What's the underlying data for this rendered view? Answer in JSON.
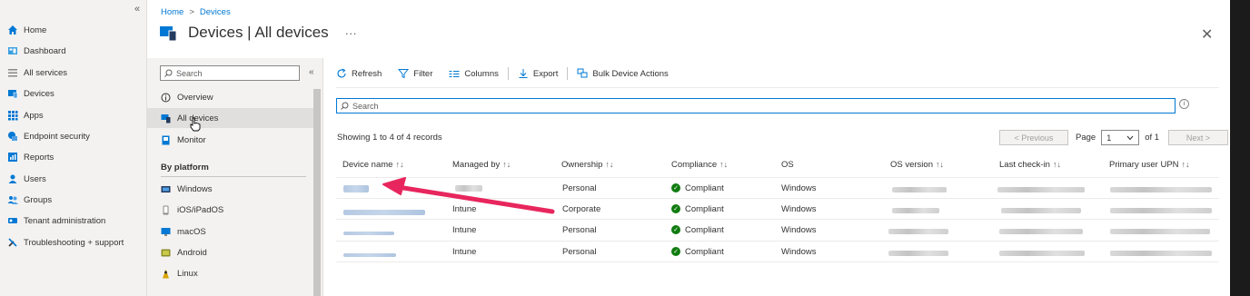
{
  "leftnav": {
    "collapse_glyph": "«",
    "items": [
      {
        "label": "Home",
        "icon": "home-icon",
        "color": "#0078d4"
      },
      {
        "label": "Dashboard",
        "icon": "dashboard-icon",
        "color": "#3aa0e0"
      },
      {
        "label": "All services",
        "icon": "list-icon",
        "color": "#8a8886"
      },
      {
        "label": "Devices",
        "icon": "devices-icon",
        "color": "#0078d4"
      },
      {
        "label": "Apps",
        "icon": "apps-icon",
        "color": "#0078d4"
      },
      {
        "label": "Endpoint security",
        "icon": "endpoint-security-icon",
        "color": "#0078d4"
      },
      {
        "label": "Reports",
        "icon": "reports-icon",
        "color": "#0078d4"
      },
      {
        "label": "Users",
        "icon": "users-icon",
        "color": "#0078d4"
      },
      {
        "label": "Groups",
        "icon": "groups-icon",
        "color": "#0078d4"
      },
      {
        "label": "Tenant administration",
        "icon": "tenant-admin-icon",
        "color": "#0078d4"
      },
      {
        "label": "Troubleshooting + support",
        "icon": "wrench-icon",
        "color": "#323130"
      }
    ]
  },
  "breadcrumb": {
    "home": "Home",
    "sep": ">",
    "current": "Devices"
  },
  "header": {
    "title": "Devices | All devices",
    "more": "···",
    "close": "✕"
  },
  "blade": {
    "search_placeholder": "Search",
    "collapse": "«",
    "items": [
      {
        "label": "Overview",
        "icon": "info-icon"
      },
      {
        "label": "All devices",
        "icon": "all-devices-icon",
        "selected": true
      },
      {
        "label": "Monitor",
        "icon": "monitor-icon"
      }
    ],
    "platform_heading": "By platform",
    "platforms": [
      {
        "label": "Windows",
        "icon": "windows-icon"
      },
      {
        "label": "iOS/iPadOS",
        "icon": "ios-icon"
      },
      {
        "label": "macOS",
        "icon": "macos-icon"
      },
      {
        "label": "Android",
        "icon": "android-icon"
      },
      {
        "label": "Linux",
        "icon": "linux-icon"
      }
    ]
  },
  "toolbar": {
    "refresh": "Refresh",
    "filter": "Filter",
    "columns": "Columns",
    "export": "Export",
    "bulk": "Bulk Device Actions"
  },
  "search": {
    "placeholder": "Search",
    "info": "i"
  },
  "records": "Showing 1 to 4 of 4 records",
  "pager": {
    "previous": "< Previous",
    "page_label": "Page",
    "page_value": "1",
    "of": "of 1",
    "next": "Next >"
  },
  "table": {
    "columns": [
      "Device name",
      "Managed by",
      "Ownership",
      "Compliance",
      "OS",
      "OS version",
      "Last check-in",
      "Primary user UPN"
    ],
    "sortable": [
      true,
      true,
      true,
      true,
      false,
      true,
      true,
      true
    ],
    "sort_glyph": "↑↓",
    "rows": [
      {
        "managed_by": "",
        "ownership": "Personal",
        "compliance": "Compliant",
        "os": "Windows"
      },
      {
        "managed_by": "Intune",
        "ownership": "Corporate",
        "compliance": "Compliant",
        "os": "Windows"
      },
      {
        "managed_by": "Intune",
        "ownership": "Personal",
        "compliance": "Compliant",
        "os": "Windows"
      },
      {
        "managed_by": "Intune",
        "ownership": "Personal",
        "compliance": "Compliant",
        "os": "Windows"
      }
    ]
  },
  "colors": {
    "accent": "#0078d4",
    "compliant": "#107c10",
    "arrow": "#e8265e"
  }
}
